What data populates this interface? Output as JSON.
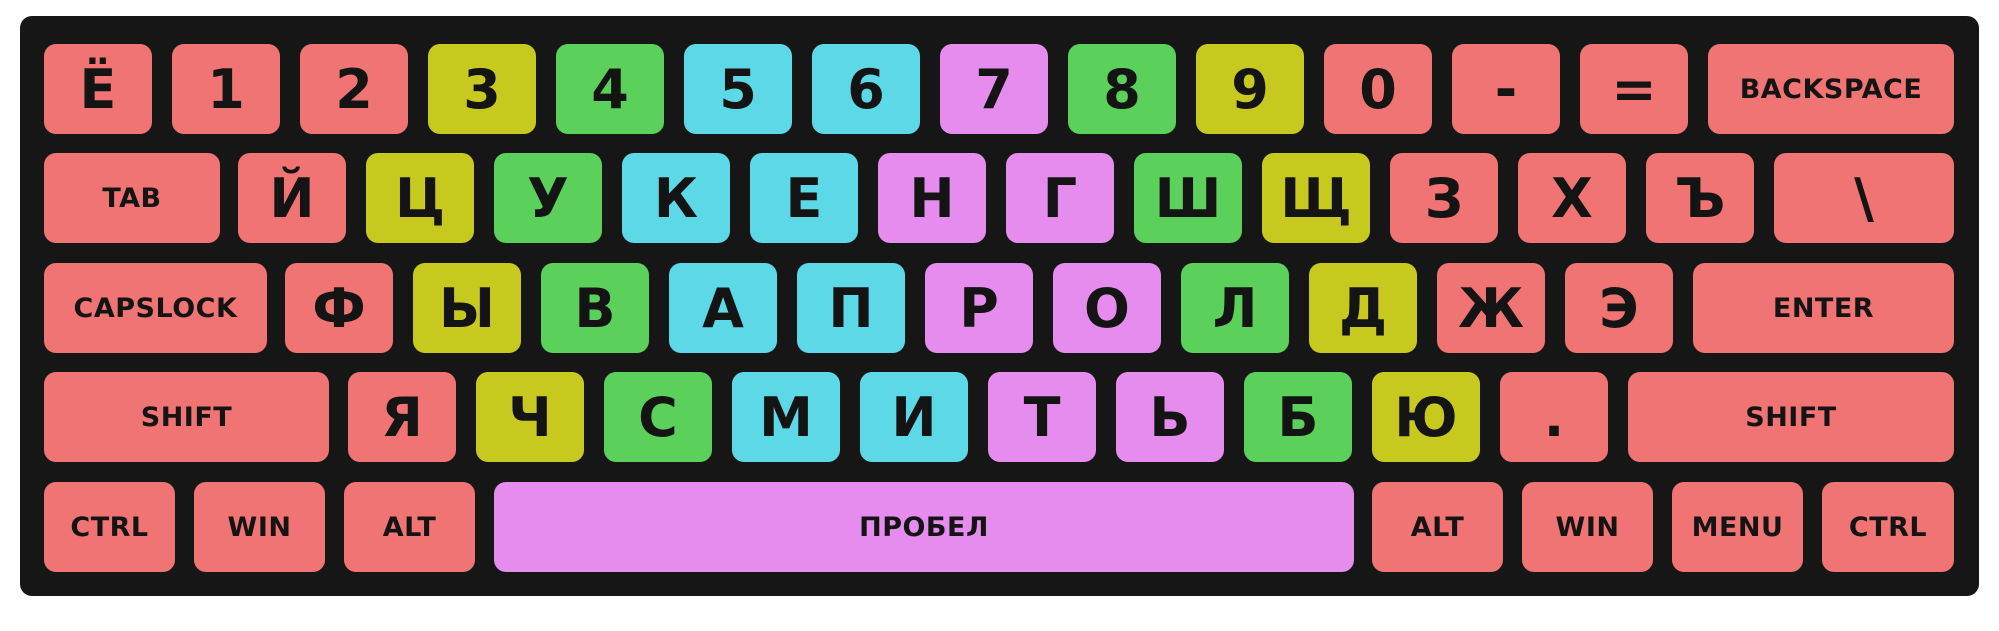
{
  "colors": {
    "pinky": "#f07474",
    "ring": "#c8c91e",
    "middle": "#5bd05b",
    "index_left": "#5cd8e6",
    "index_right": "#e68cee",
    "thumb": "#e68cee",
    "board": "#161616"
  },
  "rows": [
    [
      {
        "label": "Ё",
        "zone": "pinky"
      },
      {
        "label": "1",
        "zone": "pinky"
      },
      {
        "label": "2",
        "zone": "pinky"
      },
      {
        "label": "3",
        "zone": "ring"
      },
      {
        "label": "4",
        "zone": "middle"
      },
      {
        "label": "5",
        "zone": "index_left"
      },
      {
        "label": "6",
        "zone": "index_left"
      },
      {
        "label": "7",
        "zone": "index_right"
      },
      {
        "label": "8",
        "zone": "middle"
      },
      {
        "label": "9",
        "zone": "ring"
      },
      {
        "label": "0",
        "zone": "pinky"
      },
      {
        "label": "-",
        "zone": "pinky"
      },
      {
        "label": "=",
        "zone": "pinky"
      },
      {
        "label": "BACKSPACE",
        "zone": "pinky"
      }
    ],
    [
      {
        "label": "TAB",
        "zone": "pinky"
      },
      {
        "label": "Й",
        "zone": "pinky"
      },
      {
        "label": "Ц",
        "zone": "ring"
      },
      {
        "label": "У",
        "zone": "middle"
      },
      {
        "label": "К",
        "zone": "index_left"
      },
      {
        "label": "Е",
        "zone": "index_left"
      },
      {
        "label": "Н",
        "zone": "index_right"
      },
      {
        "label": "Г",
        "zone": "index_right"
      },
      {
        "label": "Ш",
        "zone": "middle"
      },
      {
        "label": "Щ",
        "zone": "ring"
      },
      {
        "label": "З",
        "zone": "pinky"
      },
      {
        "label": "Х",
        "zone": "pinky"
      },
      {
        "label": "Ъ",
        "zone": "pinky"
      },
      {
        "label": "\\",
        "zone": "pinky"
      }
    ],
    [
      {
        "label": "CAPSLOCK",
        "zone": "pinky"
      },
      {
        "label": "Ф",
        "zone": "pinky"
      },
      {
        "label": "Ы",
        "zone": "ring"
      },
      {
        "label": "В",
        "zone": "middle"
      },
      {
        "label": "А",
        "zone": "index_left"
      },
      {
        "label": "П",
        "zone": "index_left"
      },
      {
        "label": "Р",
        "zone": "index_right"
      },
      {
        "label": "О",
        "zone": "index_right"
      },
      {
        "label": "Л",
        "zone": "middle"
      },
      {
        "label": "Д",
        "zone": "ring"
      },
      {
        "label": "Ж",
        "zone": "pinky"
      },
      {
        "label": "Э",
        "zone": "pinky"
      },
      {
        "label": "ENTER",
        "zone": "pinky"
      }
    ],
    [
      {
        "label": "SHIFT",
        "zone": "pinky"
      },
      {
        "label": "Я",
        "zone": "pinky"
      },
      {
        "label": "Ч",
        "zone": "ring"
      },
      {
        "label": "С",
        "zone": "middle"
      },
      {
        "label": "М",
        "zone": "index_left"
      },
      {
        "label": "И",
        "zone": "index_left"
      },
      {
        "label": "Т",
        "zone": "index_right"
      },
      {
        "label": "Ь",
        "zone": "index_right"
      },
      {
        "label": "Б",
        "zone": "middle"
      },
      {
        "label": "Ю",
        "zone": "ring"
      },
      {
        "label": ".",
        "zone": "pinky"
      },
      {
        "label": "SHIFT",
        "zone": "pinky"
      }
    ],
    [
      {
        "label": "CTRL",
        "zone": "pinky"
      },
      {
        "label": "WIN",
        "zone": "pinky"
      },
      {
        "label": "ALT",
        "zone": "pinky"
      },
      {
        "label": "ПРОБЕЛ",
        "zone": "thumb"
      },
      {
        "label": "ALT",
        "zone": "pinky"
      },
      {
        "label": "WIN",
        "zone": "pinky"
      },
      {
        "label": "MENU",
        "zone": "pinky"
      },
      {
        "label": "CTRL",
        "zone": "pinky"
      }
    ]
  ]
}
